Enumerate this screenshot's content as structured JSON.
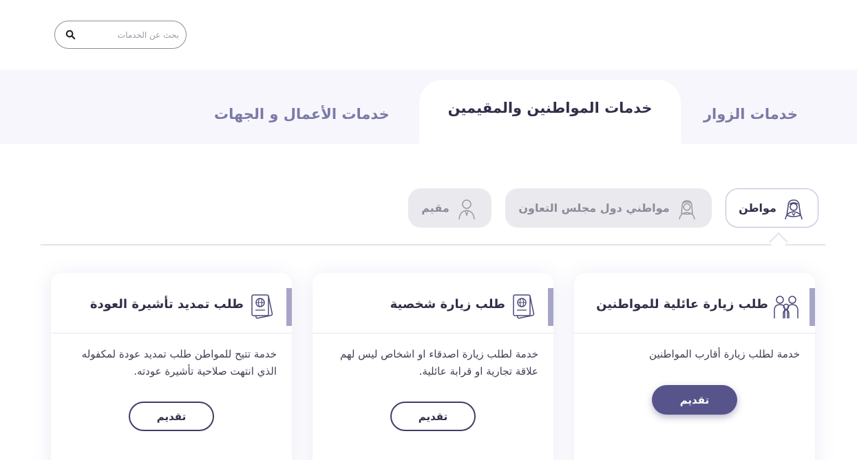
{
  "search": {
    "placeholder": "بحث عن الخدمات",
    "icon": "search-icon"
  },
  "tabs": [
    {
      "label": "خدمات الزوار",
      "active": false
    },
    {
      "label": "خدمات المواطنين والمقيمين",
      "active": true
    },
    {
      "label": "خدمات الأعمال و الجهات",
      "active": false
    }
  ],
  "audiences": [
    {
      "label": "مواطن",
      "icon": "citizen-icon",
      "active": true
    },
    {
      "label": "مواطني دول مجلس التعاون",
      "icon": "gcc-citizen-icon",
      "active": false
    },
    {
      "label": "مقيم",
      "icon": "resident-icon",
      "active": false
    }
  ],
  "cards": [
    {
      "title": "طلب زيارة عائلية للمواطنين",
      "icon": "family-icon",
      "description": "خدمة لطلب زيارة أقارب المواطنين",
      "button": "تقديم",
      "button_style": "filled"
    },
    {
      "title": "طلب زيارة شخصية",
      "icon": "passport-icon",
      "description": "خدمة لطلب زيارة اصدقاء او اشخاص ليس لهم علاقة تجارية او قرابة عائلية.",
      "button": "تقديم",
      "button_style": "outline"
    },
    {
      "title": "طلب تمديد تأشيرة العودة",
      "icon": "passport-icon",
      "description": "خدمة تتيح للمواطن طلب تمديد عودة لمكفوله الذي انتهت صلاحية تأشيرة عودته.",
      "button": "تقديم",
      "button_style": "outline"
    }
  ],
  "colors": {
    "accent": "#56548a",
    "tab_inactive": "#7b7aa6",
    "band": "#f7f6fc",
    "pill_inactive": "#e9e9ee"
  }
}
